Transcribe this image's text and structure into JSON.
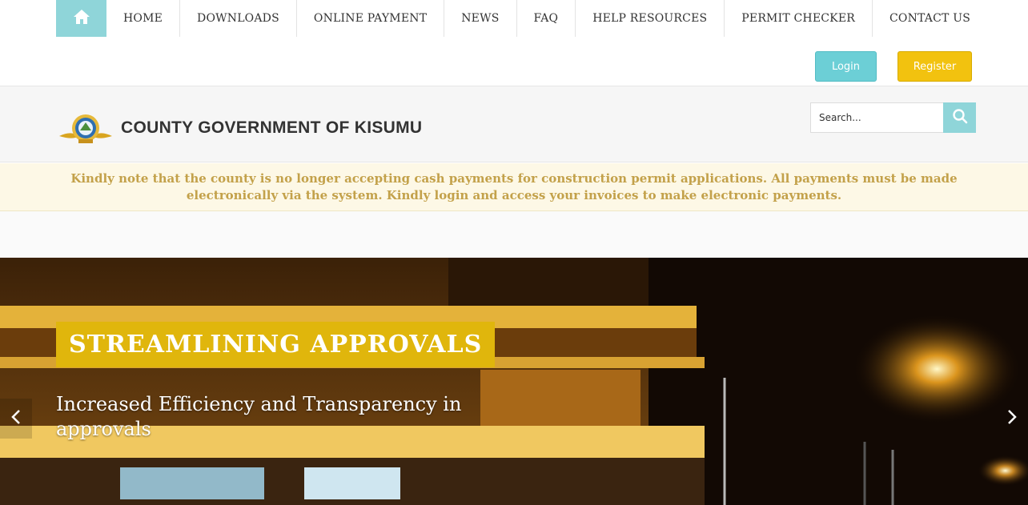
{
  "nav": {
    "home_icon": "home-icon",
    "items": [
      "HOME",
      "DOWNLOADS",
      "ONLINE PAYMENT",
      "NEWS",
      "FAQ",
      "HELP RESOURCES",
      "PERMIT CHECKER",
      "CONTACT US"
    ]
  },
  "auth": {
    "login_label": "Login",
    "register_label": "Register"
  },
  "header": {
    "title": "COUNTY GOVERNMENT OF KISUMU",
    "search_placeholder": "Search...",
    "search_icon": "search-icon"
  },
  "notice": {
    "text": "Kindly note that the county is no longer accepting cash payments for construction permit applications. All payments must be made electronically via the system. Kindly login and access your invoices to make electronic payments."
  },
  "hero": {
    "title": "STREAMLINING APPROVALS",
    "subtitle": "Increased Efficiency and Transparency in approvals"
  },
  "colors": {
    "accent_teal": "#8fd5d9",
    "register_yellow": "#f2c20f",
    "hero_title_bg": "#e0b60c",
    "notice_text": "#c3a14a"
  }
}
